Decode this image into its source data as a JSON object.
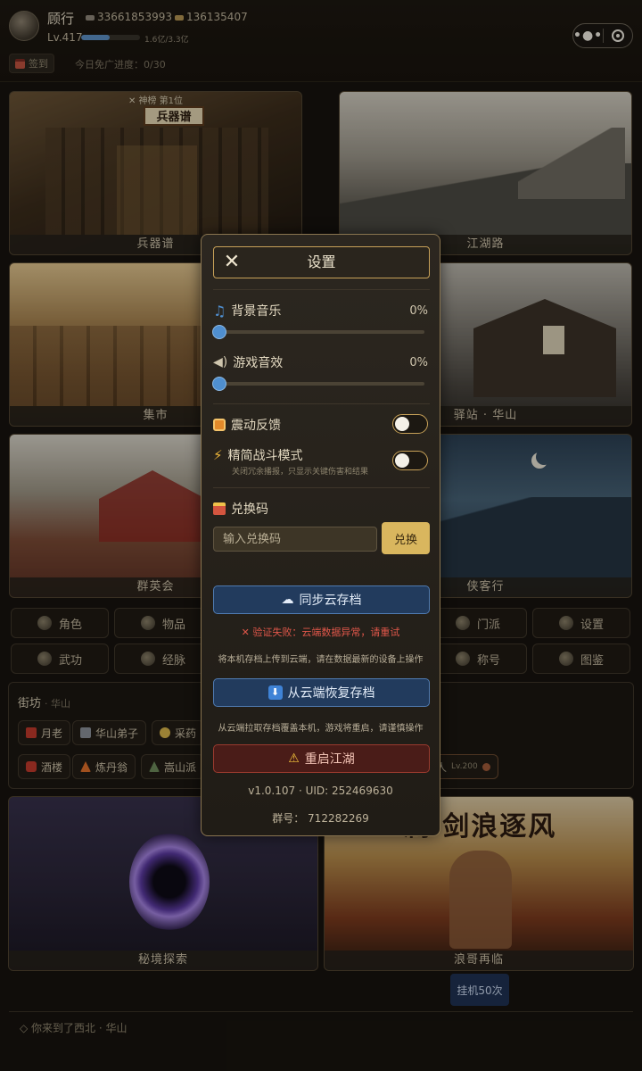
{
  "header": {
    "player_name": "顾行",
    "silver": "33661853993",
    "gold": "136135407",
    "level": "Lv.417",
    "exp_fraction": 0.48,
    "exp_text": "1.6亿/3.3亿",
    "checkin_label": "签到",
    "ad_progress": "今日免广进度：0/30",
    "menu_icon": "more-dots-icon",
    "close_icon": "target-icon"
  },
  "map": {
    "rank_tag": "✕ 神榜 第1位",
    "armory_sign": "兵器谱",
    "cards": [
      "兵器谱",
      "江湖路",
      "集市",
      "驿站 · 华山",
      "群英会",
      "侠客行",
      "秘境探索",
      "浪哥再临"
    ],
    "banner_text": "澜·剑浪逐风"
  },
  "nav": {
    "left": [
      "角色",
      "物品",
      "武功",
      "经脉"
    ],
    "right": [
      "门派",
      "设置",
      "称号",
      "图鉴"
    ]
  },
  "street": {
    "title": "街坊",
    "subtitle": "· 华山",
    "npcs": [
      "月老",
      "华山弟子",
      "采药",
      "酒楼",
      "炼丹翁",
      "嵩山派"
    ],
    "npc_partial": "人",
    "npc_level": "Lv.200"
  },
  "footer": {
    "idle_button": "挂机50次",
    "log": "你来到了西北 · 华山"
  },
  "settings": {
    "title": "设置",
    "bgm_label": "背景音乐",
    "bgm_value": "0%",
    "bgm_level": 0,
    "sfx_label": "游戏音效",
    "sfx_value": "0%",
    "sfx_level": 0,
    "vibration_label": "震动反馈",
    "vibration_on": false,
    "simple_battle_label": "精简战斗模式",
    "simple_battle_desc": "关闭冗余播报，只显示关键伤害和结果",
    "simple_battle_on": false,
    "redeem_label": "兑换码",
    "redeem_placeholder": "输入兑换码",
    "redeem_button": "兑换",
    "sync_button": "同步云存档",
    "sync_error": "验证失败：云端数据异常，请重试",
    "sync_note": "将本机存档上传到云端，请在数据最新的设备上操作",
    "restore_button": "从云端恢复存档",
    "restore_note": "从云端拉取存档覆盖本机，游戏将重启，请谨慎操作",
    "restart_button": "重启江湖",
    "version_line": "v1.0.107 · UID: 252469630",
    "group_line": "群号： 712282269"
  },
  "colors": {
    "accent_gold": "#c7a158",
    "button_blue": "#223b5d",
    "danger_red": "#e0574a",
    "slider_blue": "#4f8fd0"
  }
}
